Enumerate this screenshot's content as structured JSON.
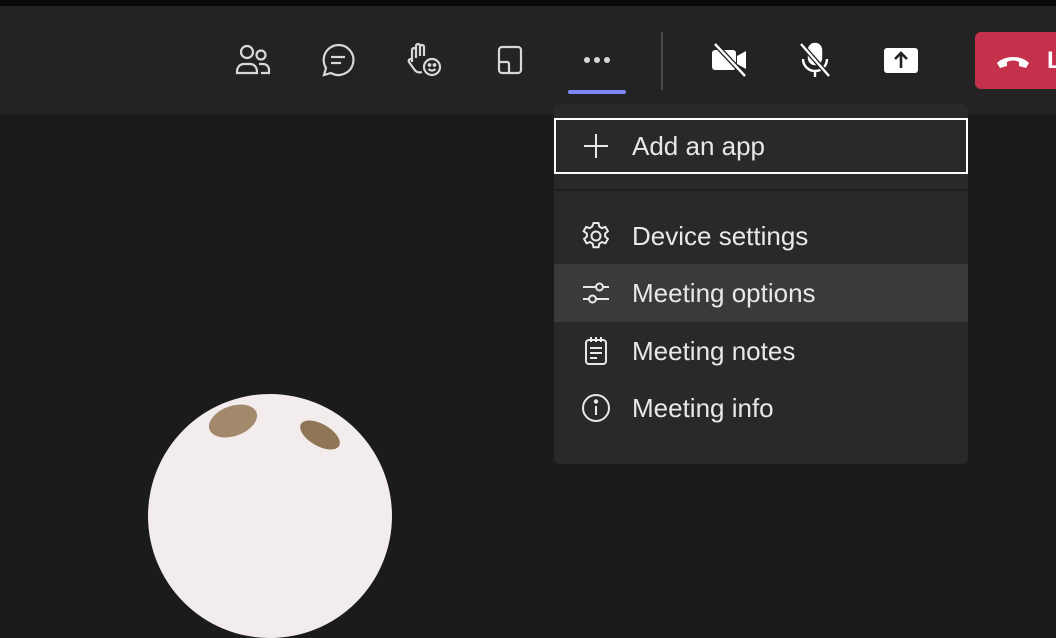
{
  "toolbar": {
    "buttons": [
      {
        "name": "people-icon"
      },
      {
        "name": "chat-icon"
      },
      {
        "name": "raise-hand-icon"
      },
      {
        "name": "view-icon"
      },
      {
        "name": "more-icon"
      },
      {
        "name": "camera-off-icon"
      },
      {
        "name": "mic-off-icon"
      },
      {
        "name": "share-icon"
      }
    ],
    "leave_label": "L",
    "leave_color": "#c4314b",
    "active_underline_color": "#7f85f5"
  },
  "menu": {
    "items": [
      {
        "label": "Add an app",
        "icon": "plus-icon"
      },
      {
        "label": "Device settings",
        "icon": "gear-icon"
      },
      {
        "label": "Meeting options",
        "icon": "sliders-icon"
      },
      {
        "label": "Meeting notes",
        "icon": "notes-icon"
      },
      {
        "label": "Meeting info",
        "icon": "info-icon"
      }
    ]
  }
}
